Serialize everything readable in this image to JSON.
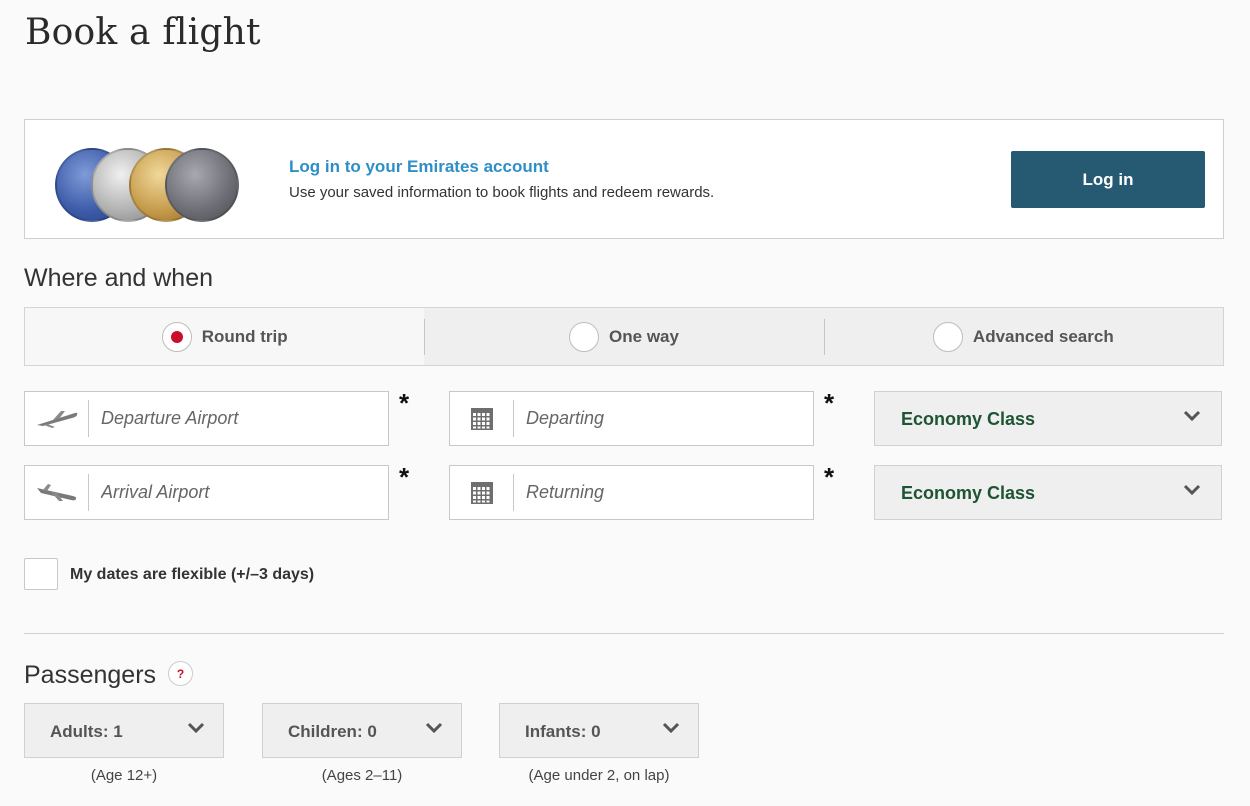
{
  "page": {
    "title": "Book a flight"
  },
  "login": {
    "medals": [
      "blue",
      "silver",
      "gold",
      "platinum"
    ],
    "title": "Log in to your Emirates account",
    "description": "Use your saved information to book flights and redeem rewards.",
    "button_label": "Log in",
    "button_color": "#265a72",
    "title_color": "#2e8fc7"
  },
  "where_when": {
    "heading": "Where and when",
    "trip_types": [
      {
        "label": "Round trip",
        "selected": true
      },
      {
        "label": "One way",
        "selected": false
      },
      {
        "label": "Advanced search",
        "selected": false
      }
    ],
    "departure_airport": {
      "placeholder": "Departure Airport",
      "value": "",
      "icon": "plane-takeoff-icon"
    },
    "arrival_airport": {
      "placeholder": "Arrival Airport",
      "value": "",
      "icon": "plane-landing-icon"
    },
    "departing": {
      "placeholder": "Departing",
      "value": "",
      "icon": "calendar-icon"
    },
    "returning": {
      "placeholder": "Returning",
      "value": "",
      "icon": "calendar-icon"
    },
    "required_marker": "*",
    "outbound_class": "Economy Class",
    "return_class": "Economy Class",
    "flexible_label": "My dates are flexible (+/–3 days)",
    "flexible_checked": false,
    "selected_radio_color": "#c8102e"
  },
  "passengers": {
    "heading": "Passengers",
    "help_symbol": "?",
    "adults": {
      "label": "Adults: 1",
      "note": "(Age 12+)"
    },
    "children": {
      "label": "Children: 0",
      "note": "(Ages 2–11)"
    },
    "infants": {
      "label": "Infants: 0",
      "note": "(Age under 2, on lap)"
    }
  }
}
